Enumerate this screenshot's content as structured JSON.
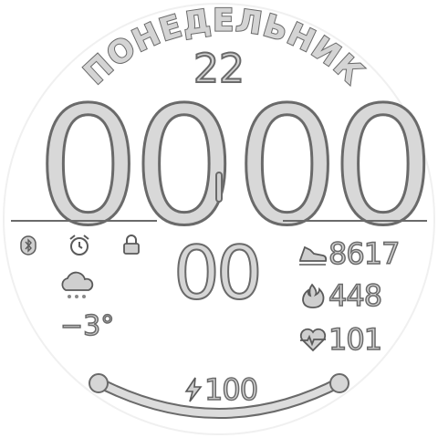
{
  "watch": {
    "day_of_week": "ПОНЕДЕЛЬНИК",
    "date": "22",
    "hours": "00",
    "minutes": "00",
    "seconds": "00"
  },
  "status_icons": [
    "bluetooth-icon",
    "alarm-icon",
    "lock-icon"
  ],
  "weather": {
    "icon": "snow-cloud-icon",
    "temperature": "−3°"
  },
  "stats": {
    "steps": "8617",
    "calories": "448",
    "heart_rate": "101"
  },
  "battery": {
    "icon": "bolt-icon",
    "level": "100"
  },
  "colors": {
    "fill": "#d4d4d4",
    "outline": "#6a6a6a",
    "background": "#ffffff"
  }
}
